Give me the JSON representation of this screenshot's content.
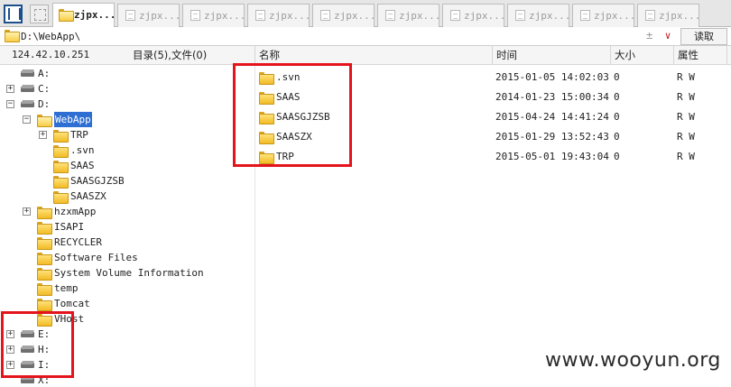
{
  "tabs": [
    {
      "label": "zjpx...",
      "active": true
    },
    {
      "label": "zjpx...",
      "active": false
    },
    {
      "label": "zjpx...",
      "active": false
    },
    {
      "label": "zjpx...",
      "active": false
    },
    {
      "label": "zjpx...",
      "active": false
    },
    {
      "label": "zjpx...",
      "active": false
    },
    {
      "label": "zjpx...",
      "active": false
    },
    {
      "label": "zjpx...",
      "active": false
    },
    {
      "label": "zjpx...",
      "active": false
    },
    {
      "label": "zjpx...",
      "active": false
    }
  ],
  "address": {
    "path": "D:\\WebApp\\",
    "options_glyph": "±",
    "dropdown_glyph": "∨",
    "read_button": "读取"
  },
  "header": {
    "ip": "124.42.10.251",
    "summary": "目录(5),文件(0)",
    "col_name": "名称",
    "col_time": "时间",
    "col_size": "大小",
    "col_attr": "属性"
  },
  "tree": [
    {
      "label": "A:",
      "type": "drive",
      "depth": 0,
      "expander": ""
    },
    {
      "label": "C:",
      "type": "drive",
      "depth": 0,
      "expander": "+"
    },
    {
      "label": "D:",
      "type": "drive",
      "depth": 0,
      "expander": "−"
    },
    {
      "label": "WebApp",
      "type": "folder-open",
      "depth": 1,
      "expander": "−",
      "selected": true
    },
    {
      "label": "TRP",
      "type": "folder",
      "depth": 2,
      "expander": "+"
    },
    {
      "label": ".svn",
      "type": "folder",
      "depth": 2,
      "expander": ""
    },
    {
      "label": "SAAS",
      "type": "folder",
      "depth": 2,
      "expander": ""
    },
    {
      "label": "SAASGJZSB",
      "type": "folder",
      "depth": 2,
      "expander": ""
    },
    {
      "label": "SAASZX",
      "type": "folder",
      "depth": 2,
      "expander": ""
    },
    {
      "label": "hzxmApp",
      "type": "folder",
      "depth": 1,
      "expander": "+"
    },
    {
      "label": "ISAPI",
      "type": "folder",
      "depth": 1,
      "expander": ""
    },
    {
      "label": "RECYCLER",
      "type": "folder",
      "depth": 1,
      "expander": ""
    },
    {
      "label": "Software Files",
      "type": "folder",
      "depth": 1,
      "expander": ""
    },
    {
      "label": "System Volume Information",
      "type": "folder",
      "depth": 1,
      "expander": ""
    },
    {
      "label": "temp",
      "type": "folder",
      "depth": 1,
      "expander": ""
    },
    {
      "label": "Tomcat",
      "type": "folder",
      "depth": 1,
      "expander": ""
    },
    {
      "label": "VHost",
      "type": "folder",
      "depth": 1,
      "expander": ""
    },
    {
      "label": "E:",
      "type": "drive",
      "depth": 0,
      "expander": "+"
    },
    {
      "label": "H:",
      "type": "drive",
      "depth": 0,
      "expander": "+"
    },
    {
      "label": "I:",
      "type": "drive",
      "depth": 0,
      "expander": "+"
    },
    {
      "label": "X:",
      "type": "drive",
      "depth": 0,
      "expander": ""
    }
  ],
  "files": [
    {
      "name": ".svn",
      "time": "2015-01-05 14:02:03",
      "size": "0",
      "attr": "R W"
    },
    {
      "name": "SAAS",
      "time": "2014-01-23 15:00:34",
      "size": "0",
      "attr": "R W"
    },
    {
      "name": "SAASGJZSB",
      "time": "2015-04-24 14:41:24",
      "size": "0",
      "attr": "R W"
    },
    {
      "name": "SAASZX",
      "time": "2015-01-29 13:52:43",
      "size": "0",
      "attr": "R W"
    },
    {
      "name": "TRP",
      "time": "2015-05-01 19:43:04",
      "size": "0",
      "attr": "R W"
    }
  ],
  "watermark": "www.wooyun.org",
  "colors": {
    "selection": "#2f6fd3",
    "annotation": "#e3141b",
    "folder": "#f2bb24"
  }
}
